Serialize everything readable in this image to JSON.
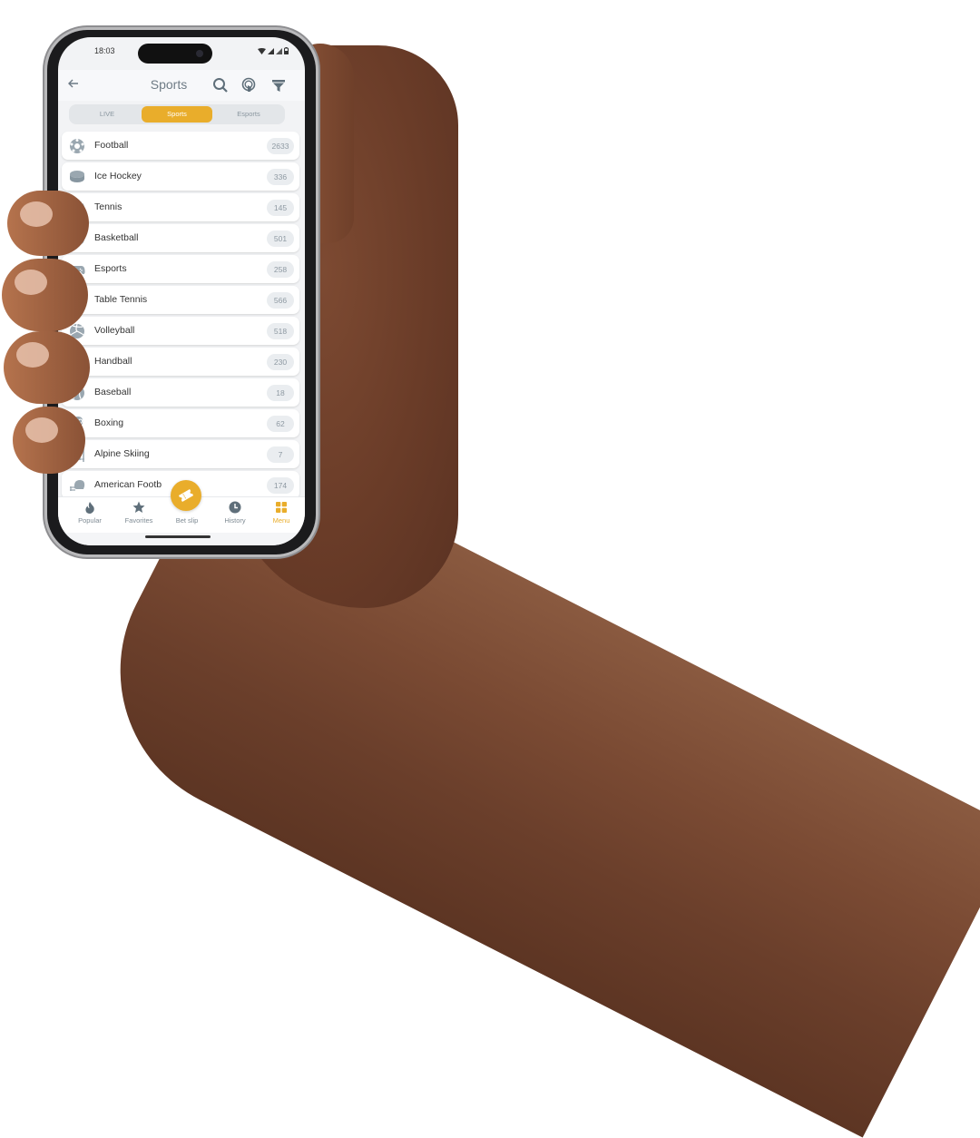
{
  "status_bar": {
    "time": "18:03"
  },
  "header": {
    "title": "Sports",
    "back_icon": "arrow-left-icon",
    "actions": [
      {
        "icon": "search-icon",
        "label": "Search"
      },
      {
        "icon": "support-icon",
        "label": "Support"
      },
      {
        "icon": "filter-icon",
        "label": "Filter"
      }
    ]
  },
  "tabs": [
    {
      "label": "LIVE",
      "active": false
    },
    {
      "label": "Sports",
      "active": true
    },
    {
      "label": "Esports",
      "active": false
    }
  ],
  "sports": [
    {
      "name": "Football",
      "count": "2633",
      "icon": "football-icon"
    },
    {
      "name": "Ice Hockey",
      "count": "336",
      "icon": "ice-hockey-icon"
    },
    {
      "name": "Tennis",
      "count": "145",
      "icon": "tennis-icon"
    },
    {
      "name": "Basketball",
      "count": "501",
      "icon": "basketball-icon"
    },
    {
      "name": "Esports",
      "count": "258",
      "icon": "gamepad-icon"
    },
    {
      "name": "Table Tennis",
      "count": "566",
      "icon": "table-tennis-icon"
    },
    {
      "name": "Volleyball",
      "count": "518",
      "icon": "volleyball-icon"
    },
    {
      "name": "Handball",
      "count": "230",
      "icon": "handball-icon"
    },
    {
      "name": "Baseball",
      "count": "18",
      "icon": "baseball-icon"
    },
    {
      "name": "Boxing",
      "count": "62",
      "icon": "boxing-glove-icon"
    },
    {
      "name": "Alpine Skiing",
      "count": "7",
      "icon": "alpine-skiing-icon"
    },
    {
      "name": "American Footb",
      "count": "174",
      "icon": "american-football-helmet-icon"
    }
  ],
  "bottom_nav": [
    {
      "label": "Popular",
      "icon": "flame-icon",
      "active": false
    },
    {
      "label": "Favorites",
      "icon": "star-icon",
      "active": false
    },
    {
      "label": "Bet slip",
      "icon": "ticket-icon",
      "active": false
    },
    {
      "label": "History",
      "icon": "clock-icon",
      "active": false
    },
    {
      "label": "Menu",
      "icon": "grid-icon",
      "active": true
    }
  ],
  "colors": {
    "accent": "#e9ad2b",
    "icon_gray": "#8e9ca6",
    "text": "#333333",
    "background": "#ffffff"
  }
}
